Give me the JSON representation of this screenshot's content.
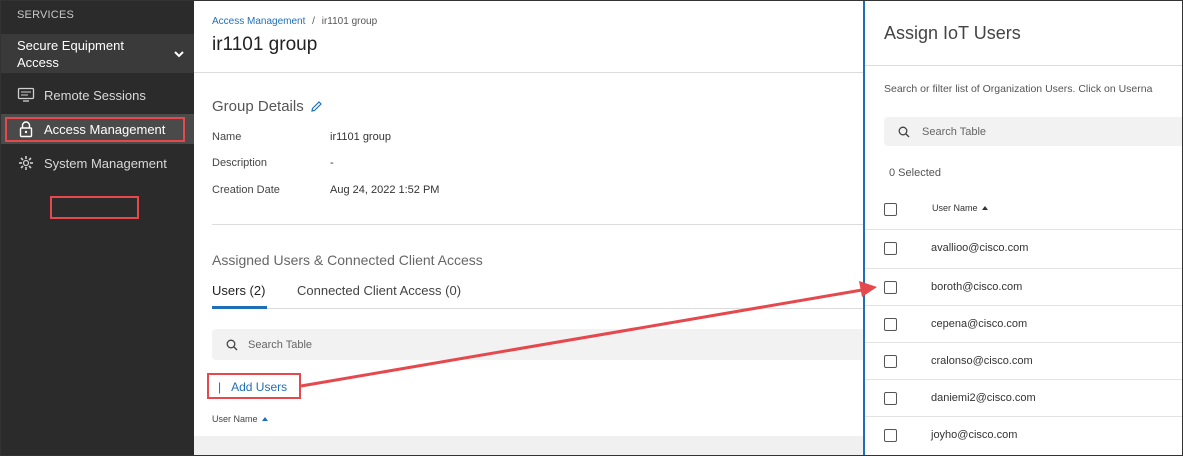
{
  "sidebar": {
    "section_title": "SERVICES",
    "group_label": "Secure Equipment Access",
    "items": [
      {
        "label": "Remote Sessions",
        "icon": "monitor-icon"
      },
      {
        "label": "Access Management",
        "icon": "lock-icon",
        "active": true
      },
      {
        "label": "System Management",
        "icon": "gear-icon"
      }
    ]
  },
  "breadcrumb": {
    "parent": "Access Management",
    "separator": "/",
    "current": "ir1101 group"
  },
  "page_title": "ir1101 group",
  "group_details": {
    "title": "Group Details",
    "fields": [
      {
        "label": "Name",
        "value": "ir1101 group"
      },
      {
        "label": "Description",
        "value": "-"
      },
      {
        "label": "Creation Date",
        "value": "Aug 24, 2022 1:52 PM"
      }
    ]
  },
  "assigned": {
    "title": "Assigned Users & Connected Client Access",
    "tabs": [
      {
        "label": "Users (2)",
        "active": true
      },
      {
        "label": "Connected Client Access (0)"
      }
    ],
    "search_placeholder": "Search Table",
    "add_users_label": "Add Users",
    "column_user_name": "User Name"
  },
  "panel": {
    "title": "Assign IoT Users",
    "description": "Search or filter list of Organization Users. Click on Userna",
    "search_placeholder": "Search Table",
    "selected_text": "0 Selected",
    "column_user_name": "User Name",
    "users": [
      "avallioo@cisco.com",
      "boroth@cisco.com",
      "cepena@cisco.com",
      "cralonso@cisco.com",
      "daniemi2@cisco.com",
      "joyho@cisco.com"
    ]
  },
  "colors": {
    "accent": "#1f6fb8",
    "annotation": "#e5484d",
    "sidebar": "#2b2b2b"
  }
}
